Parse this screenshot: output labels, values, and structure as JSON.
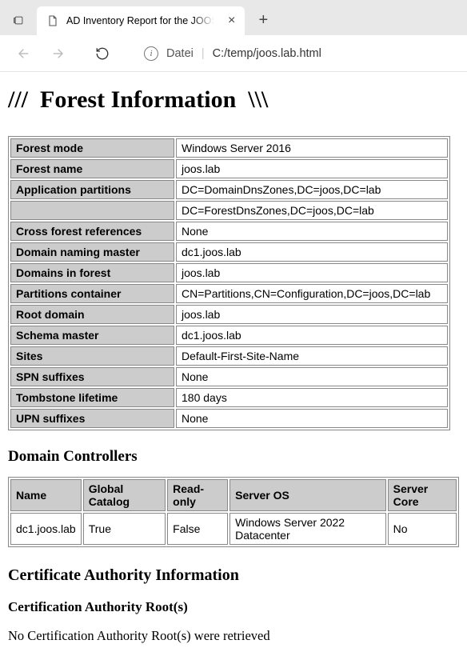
{
  "browser": {
    "tab_title": "AD Inventory Report for the JOOS",
    "new_tab_label": "+",
    "address": {
      "scheme": "Datei",
      "path": "C:/temp/joos.lab.html"
    }
  },
  "page": {
    "heading_prefix": "///",
    "heading_text": "Forest Information",
    "heading_suffix": "\\\\\\",
    "forest_rows": [
      {
        "k": "Forest mode",
        "v": "Windows Server 2016"
      },
      {
        "k": "Forest name",
        "v": "joos.lab"
      },
      {
        "k": "Application partitions",
        "v": "DC=DomainDnsZones,DC=joos,DC=lab"
      },
      {
        "k": "",
        "v": "DC=ForestDnsZones,DC=joos,DC=lab"
      },
      {
        "k": "Cross forest references",
        "v": "None"
      },
      {
        "k": "Domain naming master",
        "v": "dc1.joos.lab"
      },
      {
        "k": "Domains in forest",
        "v": "joos.lab"
      },
      {
        "k": "Partitions container",
        "v": "CN=Partitions,CN=Configuration,DC=joos,DC=lab"
      },
      {
        "k": "Root domain",
        "v": "joos.lab"
      },
      {
        "k": "Schema master",
        "v": "dc1.joos.lab"
      },
      {
        "k": "Sites",
        "v": "Default-First-Site-Name"
      },
      {
        "k": "SPN suffixes",
        "v": "None"
      },
      {
        "k": "Tombstone lifetime",
        "v": "180 days"
      },
      {
        "k": "UPN suffixes",
        "v": "None"
      }
    ],
    "dc_heading": "Domain Controllers",
    "dc_headers": [
      "Name",
      "Global Catalog",
      "Read-only",
      "Server OS",
      "Server Core"
    ],
    "dc_rows": [
      [
        "dc1.joos.lab",
        "True",
        "False",
        "Windows Server 2022 Datacenter",
        "No"
      ]
    ],
    "ca_heading": "Certificate Authority Information",
    "ca_sub_heading": "Certification Authority Root(s)",
    "ca_text": "No Certification Authority Root(s) were retrieved"
  }
}
